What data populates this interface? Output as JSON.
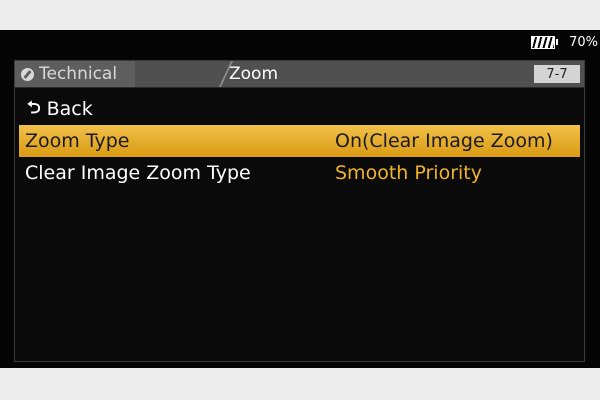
{
  "status": {
    "battery_icon": "battery-icon",
    "battery_pct": "70%"
  },
  "header": {
    "category_icon": "wrench-icon",
    "category": "Technical",
    "page_title": "Zoom",
    "page_number": "7-7"
  },
  "menu": {
    "back_label": "Back",
    "items": [
      {
        "label": "Zoom Type",
        "value": "On(Clear Image Zoom)",
        "selected": true
      },
      {
        "label": "Clear Image Zoom Type",
        "value": "Smooth Priority",
        "selected": false
      }
    ]
  },
  "colors": {
    "highlight": "#e6a823",
    "value_accent": "#f0b32a",
    "background": "#050505"
  }
}
